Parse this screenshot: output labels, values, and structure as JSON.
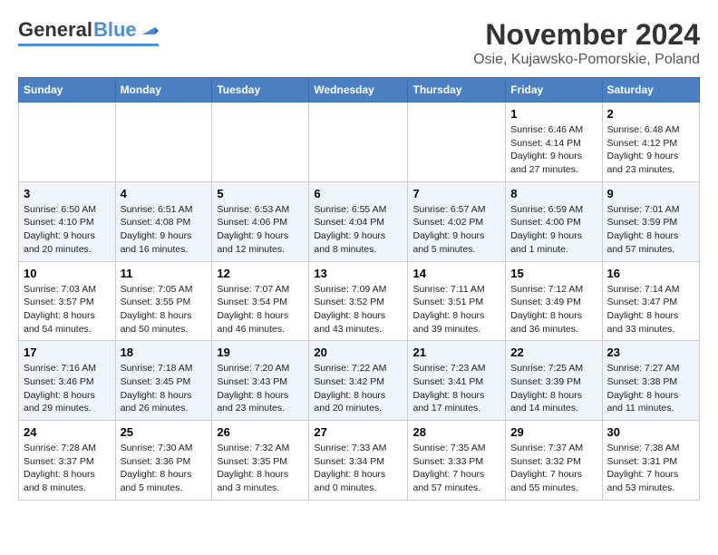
{
  "header": {
    "logo_general": "General",
    "logo_blue": "Blue",
    "title": "November 2024",
    "subtitle": "Osie, Kujawsko-Pomorskie, Poland"
  },
  "weekdays": [
    "Sunday",
    "Monday",
    "Tuesday",
    "Wednesday",
    "Thursday",
    "Friday",
    "Saturday"
  ],
  "weeks": [
    [
      {
        "day": "",
        "info": ""
      },
      {
        "day": "",
        "info": ""
      },
      {
        "day": "",
        "info": ""
      },
      {
        "day": "",
        "info": ""
      },
      {
        "day": "",
        "info": ""
      },
      {
        "day": "1",
        "info": "Sunrise: 6:46 AM\nSunset: 4:14 PM\nDaylight: 9 hours\nand 27 minutes."
      },
      {
        "day": "2",
        "info": "Sunrise: 6:48 AM\nSunset: 4:12 PM\nDaylight: 9 hours\nand 23 minutes."
      }
    ],
    [
      {
        "day": "3",
        "info": "Sunrise: 6:50 AM\nSunset: 4:10 PM\nDaylight: 9 hours\nand 20 minutes."
      },
      {
        "day": "4",
        "info": "Sunrise: 6:51 AM\nSunset: 4:08 PM\nDaylight: 9 hours\nand 16 minutes."
      },
      {
        "day": "5",
        "info": "Sunrise: 6:53 AM\nSunset: 4:06 PM\nDaylight: 9 hours\nand 12 minutes."
      },
      {
        "day": "6",
        "info": "Sunrise: 6:55 AM\nSunset: 4:04 PM\nDaylight: 9 hours\nand 8 minutes."
      },
      {
        "day": "7",
        "info": "Sunrise: 6:57 AM\nSunset: 4:02 PM\nDaylight: 9 hours\nand 5 minutes."
      },
      {
        "day": "8",
        "info": "Sunrise: 6:59 AM\nSunset: 4:00 PM\nDaylight: 9 hours\nand 1 minute."
      },
      {
        "day": "9",
        "info": "Sunrise: 7:01 AM\nSunset: 3:59 PM\nDaylight: 8 hours\nand 57 minutes."
      }
    ],
    [
      {
        "day": "10",
        "info": "Sunrise: 7:03 AM\nSunset: 3:57 PM\nDaylight: 8 hours\nand 54 minutes."
      },
      {
        "day": "11",
        "info": "Sunrise: 7:05 AM\nSunset: 3:55 PM\nDaylight: 8 hours\nand 50 minutes."
      },
      {
        "day": "12",
        "info": "Sunrise: 7:07 AM\nSunset: 3:54 PM\nDaylight: 8 hours\nand 46 minutes."
      },
      {
        "day": "13",
        "info": "Sunrise: 7:09 AM\nSunset: 3:52 PM\nDaylight: 8 hours\nand 43 minutes."
      },
      {
        "day": "14",
        "info": "Sunrise: 7:11 AM\nSunset: 3:51 PM\nDaylight: 8 hours\nand 39 minutes."
      },
      {
        "day": "15",
        "info": "Sunrise: 7:12 AM\nSunset: 3:49 PM\nDaylight: 8 hours\nand 36 minutes."
      },
      {
        "day": "16",
        "info": "Sunrise: 7:14 AM\nSunset: 3:47 PM\nDaylight: 8 hours\nand 33 minutes."
      }
    ],
    [
      {
        "day": "17",
        "info": "Sunrise: 7:16 AM\nSunset: 3:46 PM\nDaylight: 8 hours\nand 29 minutes."
      },
      {
        "day": "18",
        "info": "Sunrise: 7:18 AM\nSunset: 3:45 PM\nDaylight: 8 hours\nand 26 minutes."
      },
      {
        "day": "19",
        "info": "Sunrise: 7:20 AM\nSunset: 3:43 PM\nDaylight: 8 hours\nand 23 minutes."
      },
      {
        "day": "20",
        "info": "Sunrise: 7:22 AM\nSunset: 3:42 PM\nDaylight: 8 hours\nand 20 minutes."
      },
      {
        "day": "21",
        "info": "Sunrise: 7:23 AM\nSunset: 3:41 PM\nDaylight: 8 hours\nand 17 minutes."
      },
      {
        "day": "22",
        "info": "Sunrise: 7:25 AM\nSunset: 3:39 PM\nDaylight: 8 hours\nand 14 minutes."
      },
      {
        "day": "23",
        "info": "Sunrise: 7:27 AM\nSunset: 3:38 PM\nDaylight: 8 hours\nand 11 minutes."
      }
    ],
    [
      {
        "day": "24",
        "info": "Sunrise: 7:28 AM\nSunset: 3:37 PM\nDaylight: 8 hours\nand 8 minutes."
      },
      {
        "day": "25",
        "info": "Sunrise: 7:30 AM\nSunset: 3:36 PM\nDaylight: 8 hours\nand 5 minutes."
      },
      {
        "day": "26",
        "info": "Sunrise: 7:32 AM\nSunset: 3:35 PM\nDaylight: 8 hours\nand 3 minutes."
      },
      {
        "day": "27",
        "info": "Sunrise: 7:33 AM\nSunset: 3:34 PM\nDaylight: 8 hours\nand 0 minutes."
      },
      {
        "day": "28",
        "info": "Sunrise: 7:35 AM\nSunset: 3:33 PM\nDaylight: 7 hours\nand 57 minutes."
      },
      {
        "day": "29",
        "info": "Sunrise: 7:37 AM\nSunset: 3:32 PM\nDaylight: 7 hours\nand 55 minutes."
      },
      {
        "day": "30",
        "info": "Sunrise: 7:38 AM\nSunset: 3:31 PM\nDaylight: 7 hours\nand 53 minutes."
      }
    ]
  ]
}
